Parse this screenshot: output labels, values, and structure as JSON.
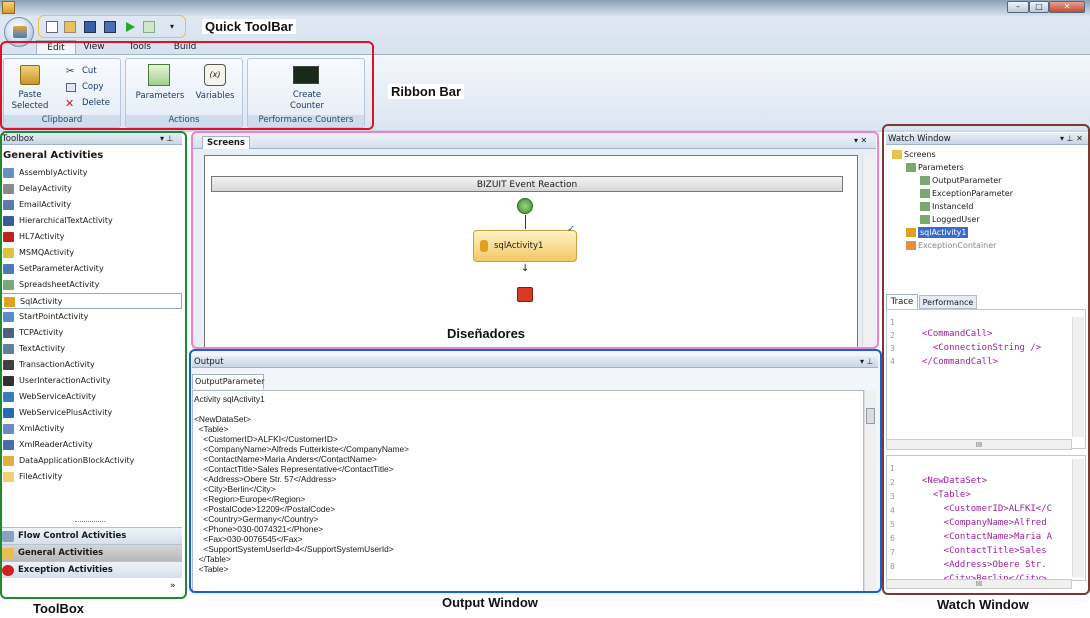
{
  "window": {
    "min_glyph": "–",
    "max_glyph": "□",
    "close_glyph": "✕"
  },
  "annotations": {
    "quick_toolbar": "Quick ToolBar",
    "ribbon_bar": "Ribbon Bar",
    "disenadores": "Diseñadores",
    "toolbox": "ToolBox",
    "output_window": "Output Window",
    "watch_window": "Watch Window"
  },
  "colors": {
    "quick_frame": "#f0c040",
    "ribbon_frame": "#e0102a",
    "toolbox_frame": "#1f8a2e",
    "designer_frame": "#f080c8",
    "output_frame": "#1560d8",
    "watch_frame": "#7a3a30"
  },
  "ribbon": {
    "tabs": [
      "Edit",
      "View",
      "Tools",
      "Build"
    ],
    "clipboard": {
      "paste": "Paste",
      "paste2": "Selected",
      "cut": "Cut",
      "copy": "Copy",
      "delete": "Delete",
      "group": "Clipboard"
    },
    "actions": {
      "parameters": "Parameters",
      "variables": "Variables",
      "group": "Actions"
    },
    "perf": {
      "create": "Create",
      "counter": "Counter",
      "group": "Performance Counters"
    }
  },
  "toolbox": {
    "title": "Toolbox",
    "header": "General Activities",
    "items": [
      "AssemblyActivity",
      "DelayActivity",
      "EmailActivity",
      "HierarchicalTextActivity",
      "HL7Activity",
      "MSMQActivity",
      "SetParameterActivity",
      "SpreadsheetActivity",
      "SqlActivity",
      "StartPointActivity",
      "TCPActivity",
      "TextActivity",
      "TransactionActivity",
      "UserInteractionActivity",
      "WebServiceActivity",
      "WebServicePlusActivity",
      "XmlActivity",
      "XmlReaderActivity",
      "DataApplicationBlockActivity",
      "FileActivity"
    ],
    "categories": [
      "Flow Control Activities",
      "General Activities",
      "Exception Activities"
    ],
    "more": "»"
  },
  "designer": {
    "tab": "Screens",
    "canvas_title": "BIZUIT Event Reaction",
    "activity": "sqlActivity1"
  },
  "output": {
    "title": "Output",
    "tab": "OutputParameter",
    "lines": [
      "Activity sqlActivity1",
      "",
      "<NewDataSet>",
      "  <Table>",
      "    <CustomerID>ALFKI</CustomerID>",
      "    <CompanyName>Alfreds Futterkiste</CompanyName>",
      "    <ContactName>Maria Anders</ContactName>",
      "    <ContactTitle>Sales Representative</ContactTitle>",
      "    <Address>Obere Str. 57</Address>",
      "    <City>Berlin</City>",
      "    <Region>Europe</Region>",
      "    <PostalCode>12209</PostalCode>",
      "    <Country>Germany</Country>",
      "    <Phone>030-0074321</Phone>",
      "    <Fax>030-0076545</Fax>",
      "    <SupportSystemUserId>4</SupportSystemUserId>",
      "  </Table>",
      "  <Table>"
    ]
  },
  "watch": {
    "title": "Watch Window",
    "tree": [
      "Screens",
      "Parameters",
      "OutputParameter",
      "ExceptionParameter",
      "InstanceId",
      "LoggedUser",
      "sqlActivity1",
      "ExceptionContainer"
    ],
    "tabs": [
      "Trace",
      "Performance"
    ],
    "trace_nums": [
      "1",
      "2",
      "3",
      "4"
    ],
    "trace_lines": [
      "<CommandCall>",
      "  <ConnectionString />",
      "</CommandCall>"
    ],
    "data_nums": [
      "1",
      "2",
      "3",
      "4",
      "5",
      "6",
      "7",
      "8"
    ],
    "data_lines": [
      "<NewDataSet>",
      "  <Table>",
      "    <CustomerID>ALFKI</C",
      "    <CompanyName>Alfred",
      "    <ContactName>Maria A",
      "    <ContactTitle>Sales",
      "    <Address>Obere Str.",
      "    <City>Berlin</City>"
    ],
    "hscroll": "III"
  }
}
